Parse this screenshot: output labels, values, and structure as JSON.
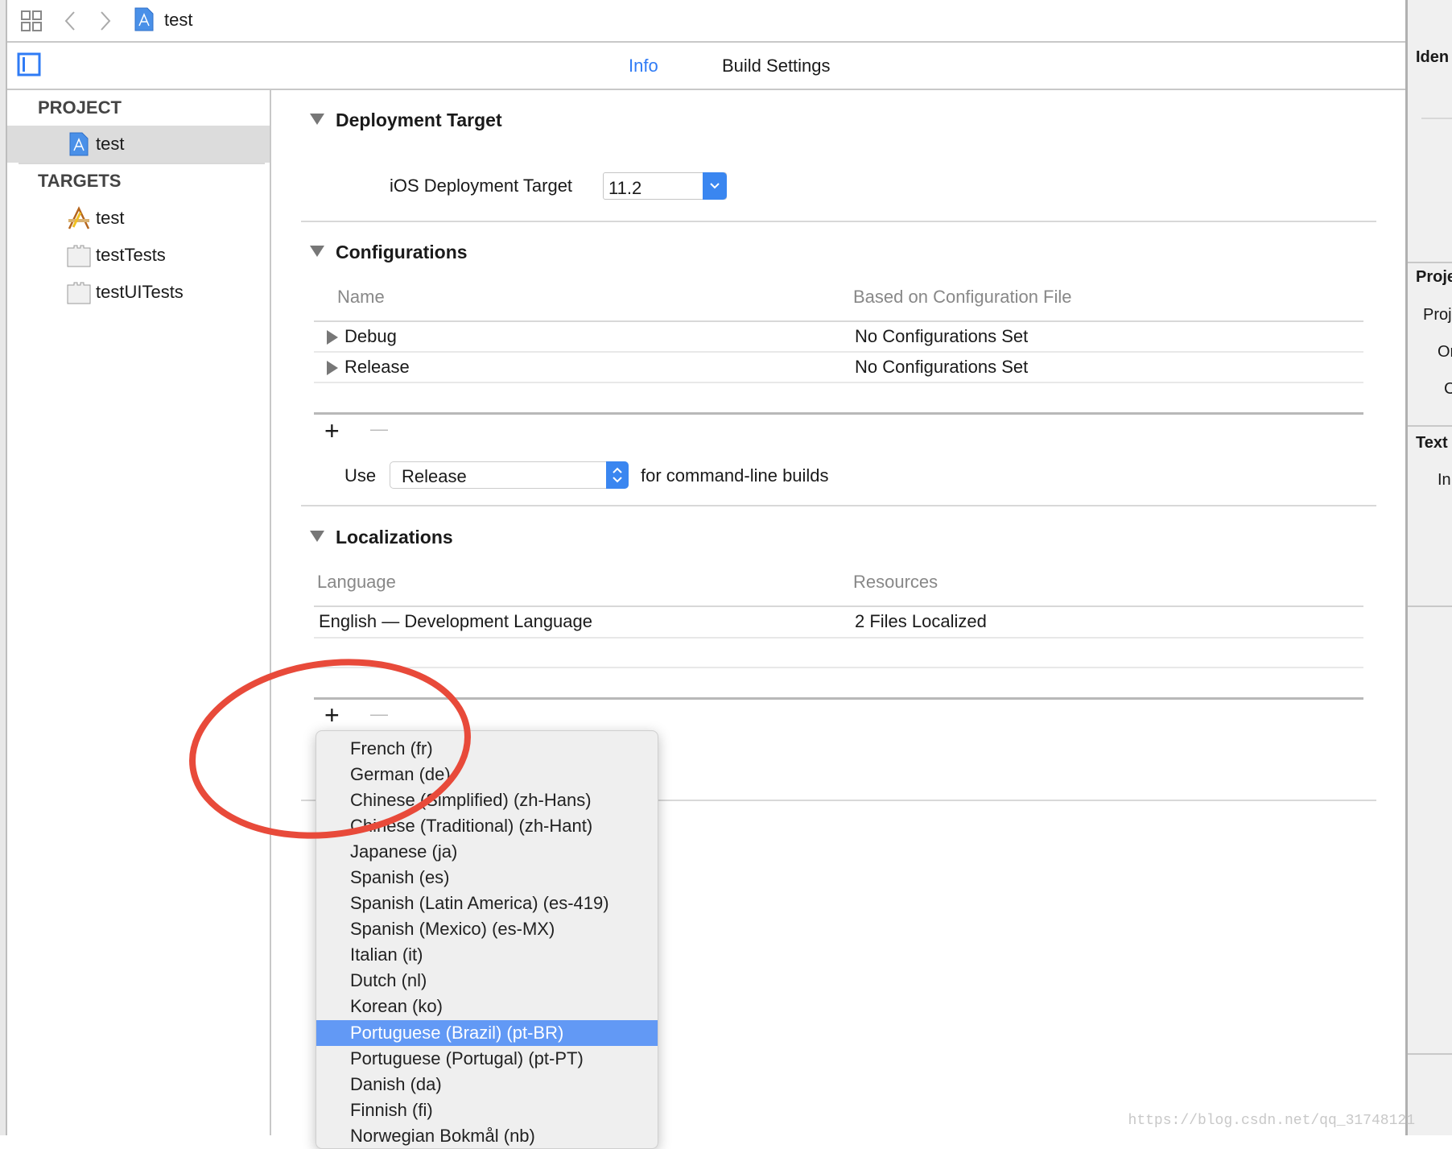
{
  "toolbar": {
    "title": "test"
  },
  "tabs": [
    {
      "label": "Info",
      "active": true
    },
    {
      "label": "Build Settings",
      "active": false
    }
  ],
  "sidebar": {
    "project_header": "PROJECT",
    "project_items": [
      {
        "label": "test",
        "icon": "project-file-icon"
      }
    ],
    "targets_header": "TARGETS",
    "target_items": [
      {
        "label": "test",
        "icon": "app-target-icon"
      },
      {
        "label": "testTests",
        "icon": "test-bundle-icon"
      },
      {
        "label": "testUITests",
        "icon": "test-bundle-icon"
      }
    ]
  },
  "deployment": {
    "title": "Deployment Target",
    "label": "iOS Deployment Target",
    "value": "11.2"
  },
  "configurations": {
    "title": "Configurations",
    "col_name": "Name",
    "col_file": "Based on Configuration File",
    "rows": [
      {
        "name": "Debug",
        "file": "No Configurations Set"
      },
      {
        "name": "Release",
        "file": "No Configurations Set"
      }
    ],
    "add": "+",
    "remove": "—",
    "use_label": "Use",
    "use_value": "Release",
    "use_suffix": "for command-line builds"
  },
  "localizations": {
    "title": "Localizations",
    "col_language": "Language",
    "col_resources": "Resources",
    "rows": [
      {
        "language": "English — Development Language",
        "resources": "2 Files Localized"
      }
    ],
    "add": "+",
    "remove": "—"
  },
  "language_menu": {
    "items": [
      "French (fr)",
      "German (de)",
      "Chinese (Simplified) (zh-Hans)",
      "Chinese (Traditional) (zh-Hant)",
      "Japanese (ja)",
      "Spanish (es)",
      "Spanish (Latin America) (es-419)",
      "Spanish (Mexico) (es-MX)",
      "Italian (it)",
      "Dutch (nl)",
      "Korean (ko)",
      "Portuguese (Brazil) (pt-BR)",
      "Portuguese (Portugal) (pt-PT)",
      "Danish (da)",
      "Finnish (fi)",
      "Norwegian Bokmål (nb)"
    ],
    "selected": "Portuguese (Brazil) (pt-BR)"
  },
  "inspector": {
    "identity": "Iden",
    "project_doc": "Proje",
    "project_format": "Proj",
    "org": "Or",
    "class": "C",
    "text_settings": "Text",
    "indent": "In"
  },
  "watermark": "https://blog.csdn.net/qq_31748121",
  "colors": {
    "accent": "#2f7bf5",
    "selection": "#6299f5",
    "annotation": "#e84a3a"
  }
}
